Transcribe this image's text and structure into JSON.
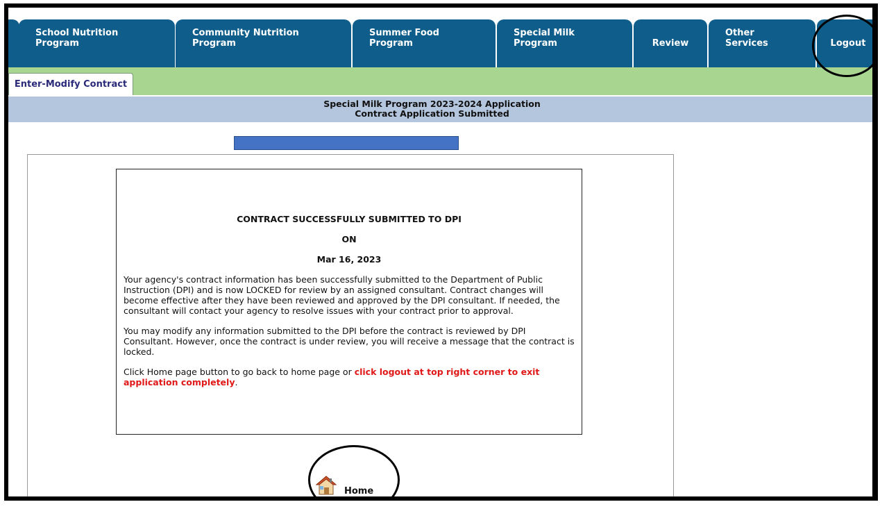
{
  "nav": {
    "tabs": [
      {
        "line1": "School Nutrition",
        "line2": "Program"
      },
      {
        "line1": "Community Nutrition",
        "line2": "Program"
      },
      {
        "line1": "Summer Food",
        "line2": "Program"
      },
      {
        "line1": "Special Milk",
        "line2": "Program"
      },
      {
        "line1": "Review",
        "line2": ""
      },
      {
        "line1": "Other",
        "line2": "Services"
      },
      {
        "line1": "Logout",
        "line2": ""
      }
    ]
  },
  "subnav": {
    "active_tab": "Enter-Modify Contract"
  },
  "header": {
    "title": "Special Milk Program 2023-2024 Application",
    "subtitle": "Contract Application Submitted"
  },
  "message": {
    "heading": "CONTRACT SUCCESSFULLY SUBMITTED TO DPI",
    "on": "ON",
    "date": "Mar 16, 2023",
    "para1": "Your agency's contract information has been successfully submitted to the Department of Public Instruction (DPI) and is now LOCKED for review by an assigned consultant. Contract changes will become effective after they have been reviewed and approved by the DPI consultant. If needed, the consultant will contact your agency to resolve issues with your contract prior to approval.",
    "para2": "You may modify any information submitted to the DPI before the contract is reviewed by DPI Consultant. However, once the contract is under review, you will receive a message that the contract is locked.",
    "para3_prefix": "Click Home page button to go back to home page or ",
    "para3_red": "click logout at top right corner to exit application completely",
    "para3_suffix": "."
  },
  "home": {
    "label": "Home",
    "icon": "home-icon"
  },
  "colors": {
    "tab_blue": "#0f5d8b",
    "subnav_green": "#a8d590",
    "title_bar": "#b4c6de",
    "progress_blue": "#4472c4",
    "warning_red": "#e01818"
  }
}
